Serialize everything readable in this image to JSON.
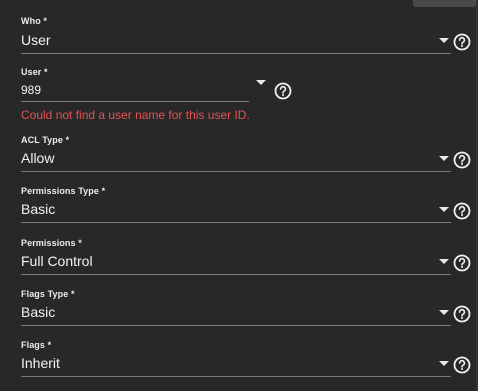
{
  "form": {
    "fields": [
      {
        "id": "who",
        "label": "Who *",
        "value": "User",
        "help_icon": "help-circle-icon"
      },
      {
        "id": "user",
        "label": "User *",
        "value": "989",
        "error": "Could not find a user name for this user ID.",
        "help_icon": "help-circle-icon"
      },
      {
        "id": "acl-type",
        "label": "ACL Type *",
        "value": "Allow",
        "help_icon": "help-circle-icon"
      },
      {
        "id": "permissions-type",
        "label": "Permissions Type *",
        "value": "Basic",
        "help_icon": "help-circle-icon"
      },
      {
        "id": "permissions",
        "label": "Permissions *",
        "value": "Full Control",
        "help_icon": "help-circle-icon"
      },
      {
        "id": "flags-type",
        "label": "Flags Type *",
        "value": "Basic",
        "help_icon": "help-circle-icon"
      },
      {
        "id": "flags",
        "label": "Flags *",
        "value": "Inherit",
        "help_icon": "help-circle-icon"
      }
    ]
  },
  "colors": {
    "background": "#282828",
    "text": "#f2f2f2",
    "underline": "#7a7a7a",
    "error": "#e35353"
  }
}
